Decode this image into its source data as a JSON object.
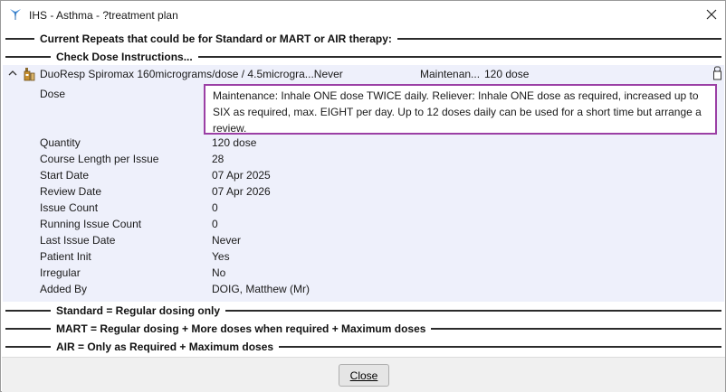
{
  "window": {
    "title": "IHS - Asthma - ?treatment plan",
    "colors": {
      "highlight_border": "#9b3fa5",
      "panel_bg": "#eef0fb"
    }
  },
  "sections": {
    "current_repeats": "Current Repeats that could be for Standard or MART or AIR therapy:",
    "check_dose": "Check Dose Instructions..."
  },
  "medication": {
    "name": "DuoResp Spiromax 160micrograms/dose / 4.5microgra...Never",
    "type": "Maintenan...",
    "quantity_summary": "120 dose",
    "details": {
      "dose_label": "Dose",
      "dose_value": "Maintenance: Inhale ONE dose TWICE daily. Reliever: Inhale ONE dose as required, increased up to SIX as required, max. EIGHT per day. Up to 12 doses daily can be used for a short time but arrange a review.",
      "rows": [
        {
          "label": "Quantity",
          "value": "120 dose"
        },
        {
          "label": "Course Length per Issue",
          "value": "28"
        },
        {
          "label": "Start Date",
          "value": "07 Apr 2025"
        },
        {
          "label": "Review Date",
          "value": "07 Apr 2026"
        },
        {
          "label": "Issue Count",
          "value": "0"
        },
        {
          "label": "Running Issue Count",
          "value": "0"
        },
        {
          "label": "Last Issue Date",
          "value": "Never"
        },
        {
          "label": "Patient Init",
          "value": "Yes"
        },
        {
          "label": "Irregular",
          "value": "No"
        },
        {
          "label": "Added By",
          "value": "DOIG, Matthew (Mr)"
        }
      ]
    }
  },
  "legend": {
    "standard": "Standard = Regular dosing only",
    "mart": "MART = Regular dosing + More doses when required + Maximum doses",
    "air": "AIR = Only as Required + Maximum doses"
  },
  "footer": {
    "close_label": "Close"
  },
  "icons": {
    "app": "ihs-logo-icon",
    "close": "close-icon",
    "collapse": "chevron-up-icon",
    "drug": "medication-icon",
    "lock": "lock-icon"
  }
}
